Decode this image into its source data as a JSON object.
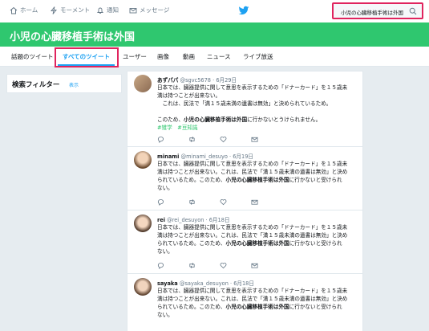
{
  "nav": {
    "home": "ホーム",
    "moments": "モーメント",
    "notifications": "通知",
    "messages": "メッセージ"
  },
  "search": {
    "value": "小児の心臓移植手術は外国"
  },
  "banner": {
    "title": "小児の心臓移植手術は外国"
  },
  "tabs": [
    {
      "label": "話題のツイート"
    },
    {
      "label": "すべてのツイート"
    },
    {
      "label": "ユーザー"
    },
    {
      "label": "画像"
    },
    {
      "label": "動画"
    },
    {
      "label": "ニュース"
    },
    {
      "label": "ライブ放送"
    }
  ],
  "filter": {
    "title": "検索フィルター",
    "show_link": "表示"
  },
  "tweets": [
    {
      "name": "あずパパ",
      "handle": "@sgvc5678",
      "date": "6月29日",
      "lines": [
        "日本では、臓器提供に関して意思を表示するための「ドナーカード」を１５歳未",
        "満は持つことが出来ない。",
        "　これは、民法で「満１５歳未満の遺書は無効」と決められているため。",
        "",
        "このため、"
      ],
      "bold": "小児の心臓移植手術は外国",
      "tail": "に行かないとうけられません。",
      "tags": "#雑学　#豆知識"
    },
    {
      "name": "minami",
      "handle": "@minami_desuyo",
      "date": "6月19日",
      "lines": [
        "日本では、臓器提供に関して意思を表示するための「ドナーカード」を１５歳未",
        "満は持つことが出来ない。これは、民法で「満１５歳未満の遺書は無効」と決め",
        "られているため。このため、"
      ],
      "bold": "小児の心臓移植手術は外国",
      "tail": "に行かないと受けられ",
      "last": "ない。"
    },
    {
      "name": "rei",
      "handle": "@rei_desuyon",
      "date": "6月18日",
      "lines": [
        "日本では、臓器提供に関して意思を表示するための「ドナーカード」を１５歳未",
        "満は持つことが出来ない。これは、民法で「満１５歳未満の遺書は無効」と決め",
        "られているため。このため、"
      ],
      "bold": "小児の心臓移植手術は外国",
      "tail": "に行かないと受けられ",
      "last": "ない。"
    },
    {
      "name": "sayaka",
      "handle": "@sayaka_desuyon",
      "date": "6月18日",
      "lines": [
        "日本では、臓器提供に関して意思を表示するための「ドナーカード」を１５歳未",
        "満は持つことが出来ない。これは、民法で「満１５歳未満の遺書は無効」と決め",
        "られているため。このため、"
      ],
      "bold": "小児の心臓移植手術は外国",
      "tail": "に行かないと受けられ",
      "last": "ない。"
    }
  ],
  "colors": {
    "accent": "#1da1f2",
    "banner": "#2fc76f",
    "highlight": "#e0245e"
  }
}
